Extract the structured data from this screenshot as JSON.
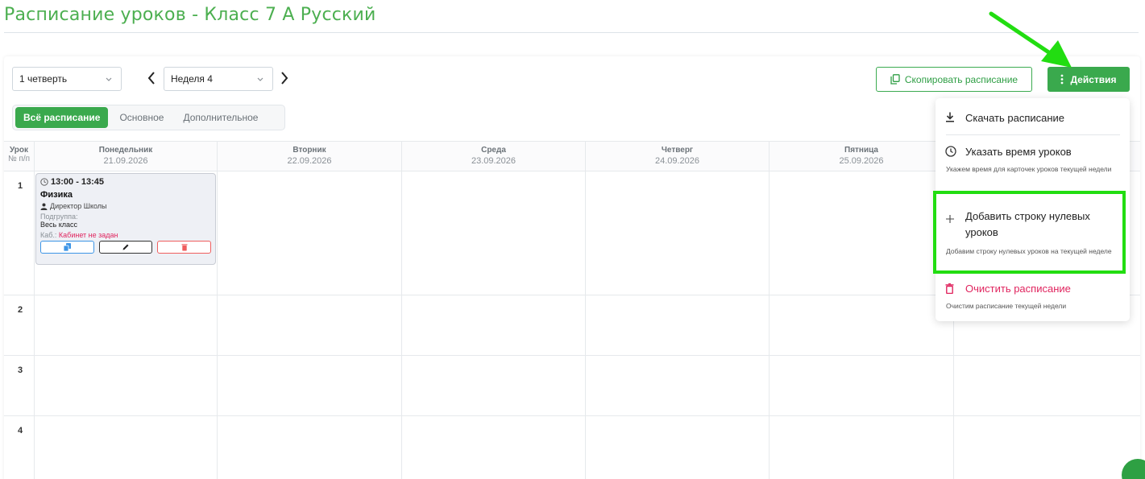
{
  "page": {
    "title": "Расписание уроков - Класс 7 А Русский"
  },
  "toolbar": {
    "quarter_value": "1 четверть",
    "week_value": "Неделя 4",
    "copy_label": "Скопировать расписание",
    "actions_label": "Действия"
  },
  "tabs": [
    {
      "label": "Всё расписание",
      "active": true
    },
    {
      "label": "Основное",
      "active": false
    },
    {
      "label": "Дополнительное",
      "active": false
    }
  ],
  "grid": {
    "lesson_header": "Урок",
    "number_header": "№ п/п",
    "days": [
      {
        "name": "Понедельник",
        "date": "21.09.2026"
      },
      {
        "name": "Вторник",
        "date": "22.09.2026"
      },
      {
        "name": "Среда",
        "date": "23.09.2026"
      },
      {
        "name": "Четверг",
        "date": "24.09.2026"
      },
      {
        "name": "Пятница",
        "date": "25.09.2026"
      }
    ],
    "rows": [
      "1",
      "2",
      "3",
      "4"
    ]
  },
  "lesson": {
    "time": "13:00 - 13:45",
    "subject": "Физика",
    "teacher": "Директор Школы",
    "subgroup_label": "Подгруппа:",
    "subgroup_value": "Весь класс",
    "room_label": "Каб.:",
    "room_value": "Кабинет не задан"
  },
  "menu": {
    "download": "Скачать расписание",
    "set_time": "Указать время уроков",
    "set_time_desc": "Укажем время для карточек уроков текущей недели",
    "add_zero": "Добавить строку нулевых уроков",
    "add_zero_desc": "Добавим строку нулевых уроков на текущей неделе",
    "clear": "Очистить расписание",
    "clear_desc": "Очистим расписание текущей недели"
  },
  "colors": {
    "accent": "#3aa94d",
    "danger": "#e0245e",
    "highlight": "#22dd11",
    "title": "#4caf50"
  }
}
